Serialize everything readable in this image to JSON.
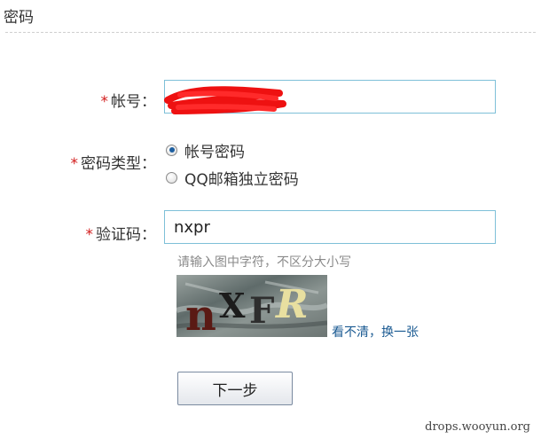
{
  "section": {
    "title": "密码"
  },
  "form": {
    "required_mark": "*",
    "account": {
      "label": "帐号："
    },
    "password_type": {
      "label": "密码类型：",
      "options": [
        {
          "label": "帐号密码",
          "checked": true
        },
        {
          "label": "QQ邮箱独立密码",
          "checked": false
        }
      ]
    },
    "captcha": {
      "label": "验证码：",
      "value": "nxpr",
      "hint": "请输入图中字符，不区分大小写",
      "refresh_link": "看不清，换一张"
    },
    "next_button": "下一步"
  },
  "captcha_image": {
    "text": "nXFR"
  },
  "watermark": "drops.wooyun.org",
  "colors": {
    "required": "#d21b1b",
    "input_border": "#7ec0d8",
    "link": "#1a5a92",
    "radio_selected": "#1d5fa0",
    "redaction": "#ee1111"
  }
}
